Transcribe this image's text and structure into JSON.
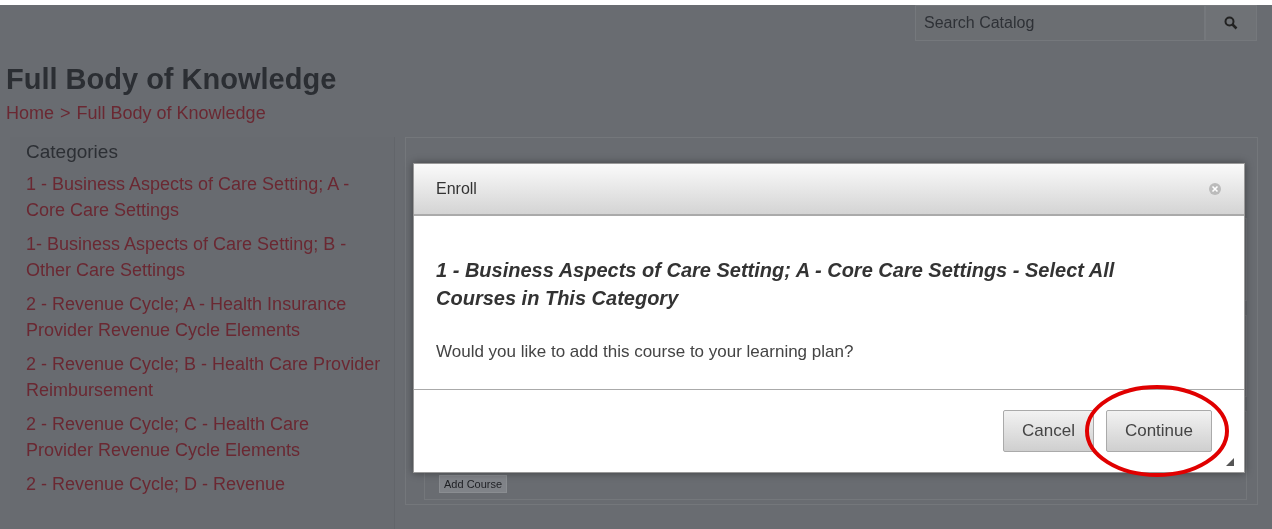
{
  "search": {
    "placeholder": "Search Catalog"
  },
  "page_title": "Full Body of Knowledge",
  "breadcrumb": [
    {
      "label": "Home"
    },
    {
      "label": ">"
    },
    {
      "label": "Full Body of Knowledge"
    }
  ],
  "categories": {
    "title": "Categories",
    "items": [
      {
        "label": "1 - Business Aspects of Care Setting; A - Core Care Settings"
      },
      {
        "label": "1- Business Aspects of Care Setting; B - Other Care Settings"
      },
      {
        "label": "2 - Revenue Cycle; A - Health Insurance Provider Revenue Cycle Elements"
      },
      {
        "label": "2 - Revenue Cycle; B - Health Care Provider Reimbursement"
      },
      {
        "label": "2 - Revenue Cycle; C - Health Care Provider Revenue Cycle Elements"
      },
      {
        "label": "2 - Revenue Cycle; D - Revenue"
      }
    ]
  },
  "content": {
    "add_button": "Add Course"
  },
  "dialog": {
    "title": "Enroll",
    "heading": "1 - Business Aspects of Care Setting; A - Core Care Settings - Select All Courses in This Category",
    "message": "Would you like to add this course to your learning plan?",
    "buttons": [
      {
        "label": "Cancel",
        "highlighted": false
      },
      {
        "label": "Continue",
        "highlighted": true
      }
    ]
  }
}
